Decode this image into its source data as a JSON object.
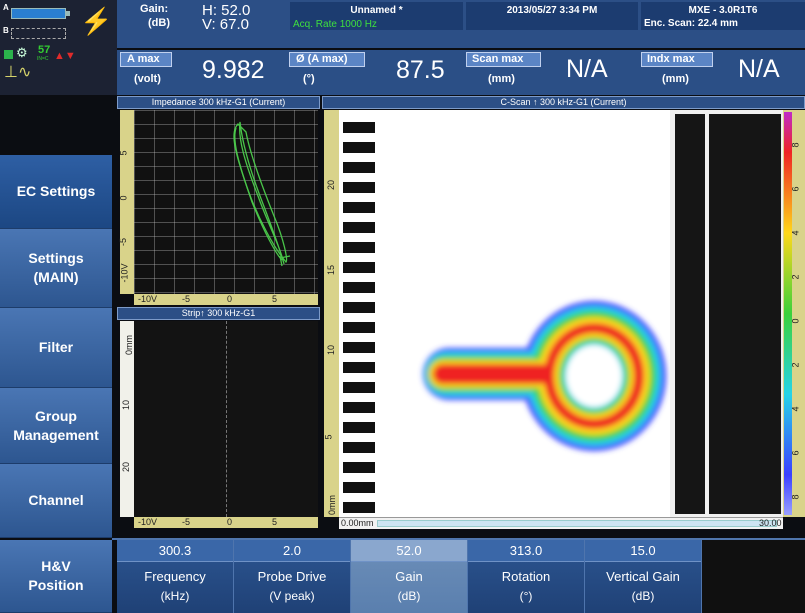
{
  "status": {
    "gain_label": "Gain:",
    "gain_unit": "(dB)",
    "h_value": "H: 52.0",
    "v_value": "V: 67.0",
    "file_name": "Unnamed *",
    "acq_rate": "Acq. Rate 1000  Hz",
    "datetime": "2013/05/27 3:34 PM",
    "device": "MXE - 3.0R1T6",
    "enc_scan": "Enc. Scan:  22.4 mm",
    "battery_temp": "57",
    "battery_temp_unit": "IN=C",
    "label_a": "A",
    "label_b": "B"
  },
  "readings": [
    {
      "name": "A max",
      "unit": "(volt)",
      "value": "9.982"
    },
    {
      "name": "Ø (A max)",
      "unit": "(°)",
      "value": "87.5"
    },
    {
      "name": "Scan max",
      "unit": "(mm)",
      "value": "N/A"
    },
    {
      "name": "Indx max",
      "unit": "(mm)",
      "value": "N/A"
    }
  ],
  "panels": {
    "impedance_title": "Impedance 300 kHz-G1 (Current)",
    "strip_title": "Strip↑ 300 kHz-G1",
    "cscan_title": "C-Scan ↑ 300 kHz-G1 (Current)",
    "imp_y_ticks": [
      "5",
      "0",
      "-5",
      "-10V"
    ],
    "imp_x_ticks": [
      "-10V",
      "-5",
      "0",
      "5"
    ],
    "strip_y_ticks": [
      "0mm",
      "10",
      "20"
    ],
    "strip_x_ticks": [
      "-10V",
      "-5",
      "0",
      "5"
    ],
    "cscan_y_ticks": [
      "20",
      "15",
      "10",
      "5",
      "0mm"
    ],
    "cscan_scan_start": "0.00mm",
    "cscan_scan_end": "30.00",
    "colorbar_ticks": [
      "8",
      "6",
      "4",
      "2",
      "0",
      "2",
      "4",
      "6",
      "8"
    ]
  },
  "sidebar": [
    {
      "label": "EC Settings",
      "active": true
    },
    {
      "label": "Settings\n(MAIN)",
      "active": false
    },
    {
      "label": "Filter",
      "active": false
    },
    {
      "label": "Group\nManagement",
      "active": false
    },
    {
      "label": "Channel",
      "active": false
    },
    {
      "label": "H&V\nPosition",
      "active": false
    }
  ],
  "params": [
    {
      "value": "300.3",
      "name": "Frequency",
      "unit": "(kHz)"
    },
    {
      "value": "2.0",
      "name": "Probe Drive",
      "unit": "(V peak)"
    },
    {
      "value": "52.0",
      "name": "Gain",
      "unit": "(dB)"
    },
    {
      "value": "313.0",
      "name": "Rotation",
      "unit": "(°)"
    },
    {
      "value": "15.0",
      "name": "Vertical Gain",
      "unit": "(dB)"
    }
  ],
  "colors": {
    "accent": "#2c4f86",
    "highlight": "#7fa3d6",
    "lissajous": "#4ccf4c"
  }
}
